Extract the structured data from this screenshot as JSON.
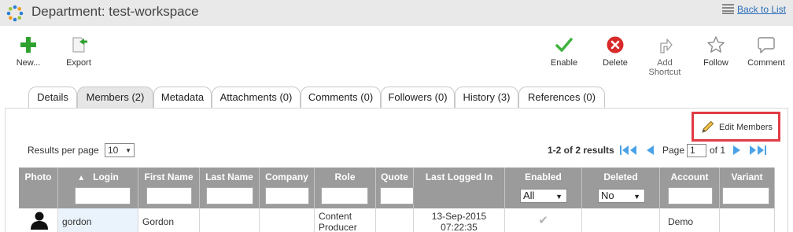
{
  "window": {
    "title": "Department: test-workspace",
    "back_link": "Back to List"
  },
  "toolbar": {
    "new_label": "New...",
    "export_label": "Export",
    "enable_label": "Enable",
    "delete_label": "Delete",
    "add_shortcut_label_1": "Add",
    "add_shortcut_label_2": "Shortcut",
    "follow_label": "Follow",
    "comment_label": "Comment"
  },
  "tabs": [
    {
      "label": "Details"
    },
    {
      "label": "Members (2)",
      "active": true
    },
    {
      "label": "Metadata"
    },
    {
      "label": "Attachments (0)"
    },
    {
      "label": "Comments (0)"
    },
    {
      "label": "Followers (0)"
    },
    {
      "label": "History (3)"
    },
    {
      "label": "References (0)"
    }
  ],
  "members": {
    "edit_members_label": "Edit Members",
    "results_per_page_label": "Results per page",
    "results_per_page_value": "10",
    "results_count": "1-2 of 2 results",
    "page_label": "Page",
    "page_value": "1",
    "page_of": "of 1"
  },
  "grid": {
    "columns": [
      "Photo",
      "Login",
      "First Name",
      "Last Name",
      "Company",
      "Role",
      "Quote",
      "Last Logged In",
      "Enabled",
      "Deleted",
      "Account",
      "Variant"
    ],
    "sort_indicator": "▲",
    "enabled_filter": "All",
    "deleted_filter": "No",
    "rows": [
      {
        "login": "gordon",
        "first_name": "Gordon",
        "last_name": "",
        "company": "",
        "role_line1": "Content",
        "role_line2": "Producer",
        "quote": "",
        "last_logged_in_1": "13-Sep-2015",
        "last_logged_in_2": "07:22:35",
        "enabled": "✔",
        "deleted": "",
        "account": "Demo",
        "variant": ""
      }
    ]
  },
  "colors": {
    "header_bg": "#9b9b9b",
    "highlight_border": "#e23b44",
    "link": "#2a6ebb",
    "pager_blue": "#4aa3e8"
  }
}
